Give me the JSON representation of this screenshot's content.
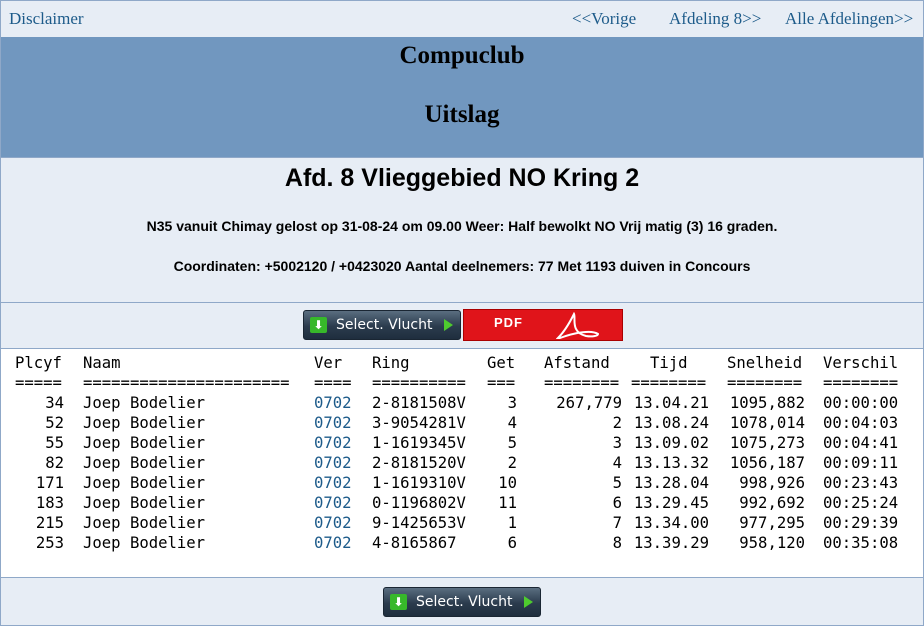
{
  "nav": {
    "disclaimer": "Disclaimer",
    "vorige": "<<Vorige",
    "afdeling": "Afdeling 8>>",
    "alle": "Alle Afdelingen>>"
  },
  "header": {
    "club": "Compuclub",
    "uitslag": "Uitslag"
  },
  "info": {
    "title": "Afd. 8 Vlieggebied NO Kring 2",
    "line1": "N35 vanuit Chimay gelost op 31-08-24 om 09.00 Weer: Half bewolkt NO Vrij matig (3) 16 graden.",
    "line2": "Coordinaten: +5002120 / +0423020 Aantal deelnemers: 77 Met 1193 duiven in Concours"
  },
  "buttons": {
    "select_label": "Select. Vlucht",
    "pdf_label": "PDF"
  },
  "table": {
    "headers": {
      "plcyf": "Plcyf",
      "naam": "Naam",
      "ver": "Ver",
      "ring": "Ring",
      "get": "Get",
      "afstand": "Afstand",
      "tijd": "Tijd",
      "snelheid": "Snelheid",
      "verschil": "Verschil"
    },
    "underlines": {
      "plcyf": "=====",
      "naam": "======================",
      "ver": "====",
      "ring": "==========",
      "get": "===",
      "afstand": "========",
      "tijd": "========",
      "snelheid": "========",
      "verschil": "========"
    },
    "rows": [
      {
        "plcyf": "34",
        "naam": "Joep Bodelier",
        "ver": "0702",
        "ring": "2-8181508V",
        "get": "3",
        "afstand": "267,779",
        "tijd": "13.04.21",
        "snelheid": "1095,882",
        "verschil": "00:00:00"
      },
      {
        "plcyf": "52",
        "naam": "Joep Bodelier",
        "ver": "0702",
        "ring": "3-9054281V",
        "get": "4",
        "afstand": "2",
        "tijd": "13.08.24",
        "snelheid": "1078,014",
        "verschil": "00:04:03"
      },
      {
        "plcyf": "55",
        "naam": "Joep Bodelier",
        "ver": "0702",
        "ring": "1-1619345V",
        "get": "5",
        "afstand": "3",
        "tijd": "13.09.02",
        "snelheid": "1075,273",
        "verschil": "00:04:41"
      },
      {
        "plcyf": "82",
        "naam": "Joep Bodelier",
        "ver": "0702",
        "ring": "2-8181520V",
        "get": "2",
        "afstand": "4",
        "tijd": "13.13.32",
        "snelheid": "1056,187",
        "verschil": "00:09:11"
      },
      {
        "plcyf": "171",
        "naam": "Joep Bodelier",
        "ver": "0702",
        "ring": "1-1619310V",
        "get": "10",
        "afstand": "5",
        "tijd": "13.28.04",
        "snelheid": "998,926",
        "verschil": "00:23:43"
      },
      {
        "plcyf": "183",
        "naam": "Joep Bodelier",
        "ver": "0702",
        "ring": "0-1196802V",
        "get": "11",
        "afstand": "6",
        "tijd": "13.29.45",
        "snelheid": "992,692",
        "verschil": "00:25:24"
      },
      {
        "plcyf": "215",
        "naam": "Joep Bodelier",
        "ver": "0702",
        "ring": "9-1425653V",
        "get": "1",
        "afstand": "7",
        "tijd": "13.34.00",
        "snelheid": "977,295",
        "verschil": "00:29:39"
      },
      {
        "plcyf": "253",
        "naam": "Joep Bodelier",
        "ver": "0702",
        "ring": "4-8165867",
        "get": "6",
        "afstand": "8",
        "tijd": "13.39.29",
        "snelheid": "958,120",
        "verschil": "00:35:08"
      }
    ]
  }
}
